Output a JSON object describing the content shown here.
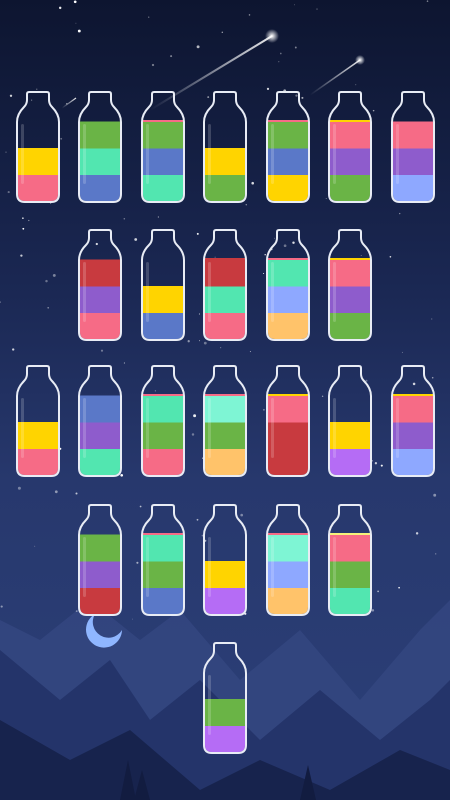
{
  "colors": {
    "background_top": "#0d1530",
    "background_bottom": "#2c4079",
    "mountain_far": "#3b4f8a",
    "mountain_near": "#1c2b57",
    "moon": "#8fb6ff",
    "glass_outline": "#e8ecf5",
    "pink": "#f66b86",
    "yellow": "#ffd400",
    "teal": "#52e6b0",
    "blue": "#5a78c8",
    "green": "#6ab446",
    "purple": "#8e5ccc",
    "red": "#c83a3f",
    "mint": "#7ef5d4",
    "lightblue": "#8ea8ff",
    "peach": "#ffc36a",
    "violet": "#b56cf5",
    "lightyellow": "#f5f27a"
  },
  "bottles": {
    "rows": [
      [
        {
          "id": "b1",
          "layers": [
            "pink",
            "yellow"
          ]
        },
        {
          "id": "b2",
          "layers": [
            "blue",
            "teal",
            "green"
          ]
        },
        {
          "id": "b3",
          "layers": [
            "teal",
            "blue",
            "green",
            "pink"
          ]
        },
        {
          "id": "b4",
          "layers": [
            "green",
            "yellow"
          ]
        },
        {
          "id": "b5",
          "layers": [
            "yellow",
            "blue",
            "green",
            "pink"
          ]
        },
        {
          "id": "b6",
          "layers": [
            "green",
            "purple",
            "pink",
            "yellow"
          ]
        },
        {
          "id": "b7",
          "layers": [
            "lightblue",
            "purple",
            "pink"
          ]
        }
      ],
      [
        {
          "id": "b8",
          "layers": [
            "pink",
            "purple",
            "red"
          ]
        },
        {
          "id": "b9",
          "layers": [
            "blue",
            "yellow"
          ]
        },
        {
          "id": "b10",
          "layers": [
            "pink",
            "teal",
            "red",
            "red"
          ]
        },
        {
          "id": "b11",
          "layers": [
            "peach",
            "lightblue",
            "teal",
            "pink"
          ]
        },
        {
          "id": "b12",
          "layers": [
            "green",
            "purple",
            "pink",
            "yellow"
          ]
        }
      ],
      [
        {
          "id": "b13",
          "layers": [
            "pink",
            "yellow"
          ]
        },
        {
          "id": "b14",
          "layers": [
            "teal",
            "purple",
            "blue"
          ]
        },
        {
          "id": "b15",
          "layers": [
            "pink",
            "green",
            "teal",
            "pink"
          ]
        },
        {
          "id": "b16",
          "layers": [
            "peach",
            "green",
            "mint",
            "pink"
          ]
        },
        {
          "id": "b17",
          "layers": [
            "red",
            "red",
            "pink",
            "yellow"
          ]
        },
        {
          "id": "b18",
          "layers": [
            "violet",
            "yellow"
          ]
        },
        {
          "id": "b19",
          "layers": [
            "lightblue",
            "purple",
            "pink",
            "yellow"
          ]
        }
      ],
      [
        {
          "id": "b20",
          "layers": [
            "red",
            "purple",
            "green"
          ]
        },
        {
          "id": "b21",
          "layers": [
            "blue",
            "green",
            "teal",
            "pink"
          ]
        },
        {
          "id": "b22",
          "layers": [
            "violet",
            "yellow"
          ]
        },
        {
          "id": "b23",
          "layers": [
            "peach",
            "lightblue",
            "mint",
            "pink"
          ]
        },
        {
          "id": "b24",
          "layers": [
            "teal",
            "green",
            "pink",
            "lightyellow"
          ]
        }
      ],
      [
        {
          "id": "b25",
          "layers": [
            "violet",
            "green"
          ]
        }
      ]
    ]
  }
}
